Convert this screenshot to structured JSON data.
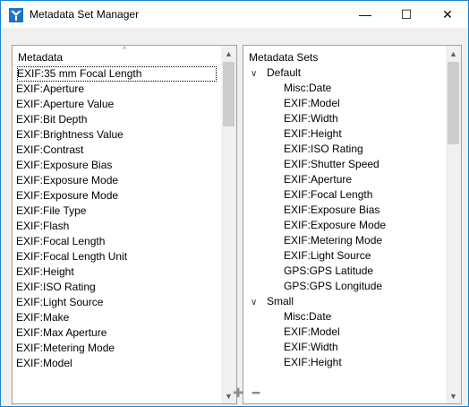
{
  "window": {
    "title": "Metadata Set Manager",
    "minimize_glyph": "—",
    "maximize_glyph": "☐",
    "close_glyph": "✕"
  },
  "left_panel": {
    "header": "Metadata",
    "sort_glyph": "^",
    "items": [
      "EXIF:35 mm Focal Length",
      "EXIF:Aperture",
      "EXIF:Aperture Value",
      "EXIF:Bit Depth",
      "EXIF:Brightness Value",
      "EXIF:Contrast",
      "EXIF:Exposure Bias",
      "EXIF:Exposure Mode",
      "EXIF:Exposure Mode",
      "EXIF:File Type",
      "EXIF:Flash",
      "EXIF:Focal Length",
      "EXIF:Focal Length Unit",
      "EXIF:Height",
      "EXIF:ISO Rating",
      "EXIF:Light Source",
      "EXIF:Make",
      "EXIF:Max Aperture",
      "EXIF:Metering Mode",
      "EXIF:Model"
    ],
    "selected_index": 0
  },
  "right_panel": {
    "header": "Metadata Sets",
    "groups": [
      {
        "name": "Default",
        "expanded_glyph": "∨",
        "items": [
          "Misc:Date",
          "EXIF:Model",
          "EXIF:Width",
          "EXIF:Height",
          "EXIF:ISO Rating",
          "EXIF:Shutter Speed",
          "EXIF:Aperture",
          "EXIF:Focal Length",
          "EXIF:Exposure Bias",
          "EXIF:Exposure Mode",
          "EXIF:Metering Mode",
          "EXIF:Light Source",
          "GPS:GPS Latitude",
          "GPS:GPS Longitude"
        ]
      },
      {
        "name": "Small",
        "expanded_glyph": "∨",
        "items": [
          "Misc:Date",
          "EXIF:Model",
          "EXIF:Width",
          "EXIF:Height"
        ]
      }
    ]
  },
  "scroll_arrows": {
    "up": "▲",
    "down": "▼"
  },
  "actions": {
    "add_glyph": "✚",
    "remove_glyph": "━"
  },
  "colors": {
    "accent": "#1883d7",
    "icon_blue": "#1e73be",
    "thumb": "#cdcdcd"
  }
}
